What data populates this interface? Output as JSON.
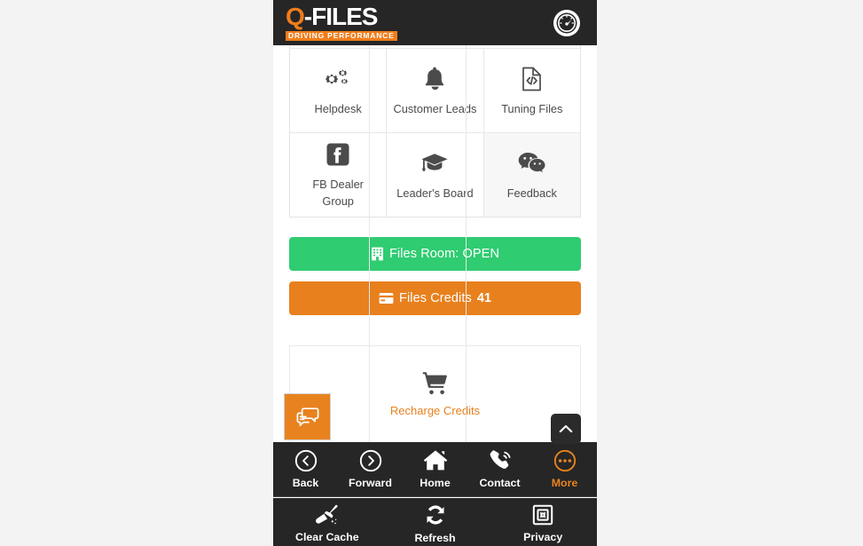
{
  "header": {
    "logo_q": "Q",
    "logo_rest": "-FILES",
    "logo_tagline": "DRIVING PERFORMANCE",
    "gauge_icon": "tachometer-icon"
  },
  "colors": {
    "orange": "#e8821e",
    "green": "#2fcc71",
    "dark": "#262626",
    "text": "#4b4b4b"
  },
  "grid": {
    "rows": [
      {
        "cells": [
          {
            "label": "Helpdesk",
            "icon": "cogs-icon",
            "hover": false
          },
          {
            "label": "Customer Leads",
            "icon": "bell-icon",
            "hover": false
          },
          {
            "label": "Tuning Files",
            "icon": "file-code-icon",
            "hover": false
          }
        ]
      },
      {
        "cells": [
          {
            "label": "FB Dealer Group",
            "icon": "facebook-square-icon",
            "hover": false
          },
          {
            "label": "Leader's Board",
            "icon": "graduation-cap-icon",
            "hover": false
          },
          {
            "label": "Feedback",
            "icon": "wechat-icon",
            "hover": true
          }
        ]
      }
    ]
  },
  "status": {
    "files_room": {
      "label": "Files Room: OPEN",
      "icon": "building-icon",
      "color": "#2fcc71"
    },
    "files_credits": {
      "label": "Files Credits",
      "value": "41",
      "icon": "credit-card-icon",
      "color": "#e8801e"
    }
  },
  "recharge": {
    "label": "Recharge Credits",
    "icon": "shopping-cart-icon"
  },
  "floating": {
    "chat": {
      "icon": "comments-icon"
    },
    "scroll_top": {
      "icon": "chevron-up-icon"
    }
  },
  "nav_main": {
    "items": [
      {
        "label": "Back",
        "icon": "arrow-circle-left-icon",
        "active": false
      },
      {
        "label": "Forward",
        "icon": "arrow-circle-right-icon",
        "active": false
      },
      {
        "label": "Home",
        "icon": "home-icon",
        "active": false
      },
      {
        "label": "Contact",
        "icon": "phone-icon",
        "active": false
      },
      {
        "label": "More",
        "icon": "ellipsis-circle-icon",
        "active": true
      }
    ]
  },
  "nav_sub": {
    "items": [
      {
        "label": "Clear Cache",
        "icon": "broom-icon"
      },
      {
        "label": "Refresh",
        "icon": "sync-icon"
      },
      {
        "label": "Privacy",
        "icon": "safe-icon"
      }
    ]
  }
}
